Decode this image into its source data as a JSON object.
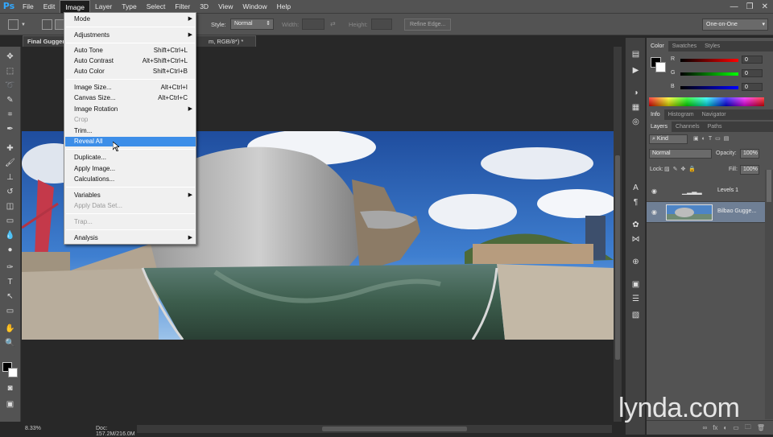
{
  "app": {
    "logo": "Ps"
  },
  "menubar": {
    "items": [
      "File",
      "Edit",
      "Image",
      "Layer",
      "Type",
      "Select",
      "Filter",
      "3D",
      "View",
      "Window",
      "Help"
    ],
    "active": "Image",
    "window_controls": [
      "—",
      "❐",
      "✕"
    ]
  },
  "options_bar": {
    "style_label": "Style:",
    "style_value": "Normal",
    "width_label": "Width:",
    "height_label": "Height:",
    "refine_edge": "Refine Edge...",
    "workspace": "One-on-One"
  },
  "document": {
    "tab_title": "Final Guggenheim.psd @ 8.3%",
    "tab_suffix": "m, RGB/8*) *",
    "zoom": "8.33%",
    "doc_info": "Doc: 157.2M/216.0M"
  },
  "image_menu": {
    "items": [
      {
        "label": "Mode",
        "submenu": true
      },
      {
        "label": "Adjustments",
        "submenu": true
      },
      {
        "label": "Auto Tone",
        "shortcut": "Shift+Ctrl+L"
      },
      {
        "label": "Auto Contrast",
        "shortcut": "Alt+Shift+Ctrl+L"
      },
      {
        "label": "Auto Color",
        "shortcut": "Shift+Ctrl+B"
      },
      {
        "label": "Image Size...",
        "shortcut": "Alt+Ctrl+I"
      },
      {
        "label": "Canvas Size...",
        "shortcut": "Alt+Ctrl+C"
      },
      {
        "label": "Image Rotation",
        "submenu": true
      },
      {
        "label": "Crop",
        "disabled": true
      },
      {
        "label": "Trim..."
      },
      {
        "label": "Reveal All",
        "highlighted": true
      },
      {
        "label": "Duplicate..."
      },
      {
        "label": "Apply Image..."
      },
      {
        "label": "Calculations..."
      },
      {
        "label": "Variables",
        "submenu": true
      },
      {
        "label": "Apply Data Set...",
        "disabled": true
      },
      {
        "label": "Trap...",
        "disabled": true
      },
      {
        "label": "Analysis",
        "submenu": true
      }
    ]
  },
  "color_panel": {
    "tabs": [
      "Color",
      "Swatches",
      "Styles"
    ],
    "channels": [
      {
        "name": "R",
        "value": "0"
      },
      {
        "name": "G",
        "value": "0"
      },
      {
        "name": "B",
        "value": "0"
      }
    ]
  },
  "info_panel": {
    "tabs": [
      "Info",
      "Histogram",
      "Navigator"
    ]
  },
  "layers_panel": {
    "tabs": [
      "Layers",
      "Channels",
      "Paths"
    ],
    "filter": "Kind",
    "blend_mode": "Normal",
    "opacity_label": "Opacity:",
    "opacity_value": "100%",
    "lock_label": "Lock:",
    "fill_label": "Fill:",
    "fill_value": "100%",
    "layers": [
      {
        "name": "Levels 1",
        "selected": false
      },
      {
        "name": "Bilbao Gugge...",
        "selected": true
      }
    ],
    "bottom_icons": [
      "∞",
      "fx",
      "◐",
      "▭",
      "🗀",
      "🗑"
    ]
  },
  "watermark": "lynda.com",
  "colors": {
    "menu_highlight": "#3d8ee8",
    "panel_bg": "#535353",
    "ps_blue": "#31a8ff"
  }
}
